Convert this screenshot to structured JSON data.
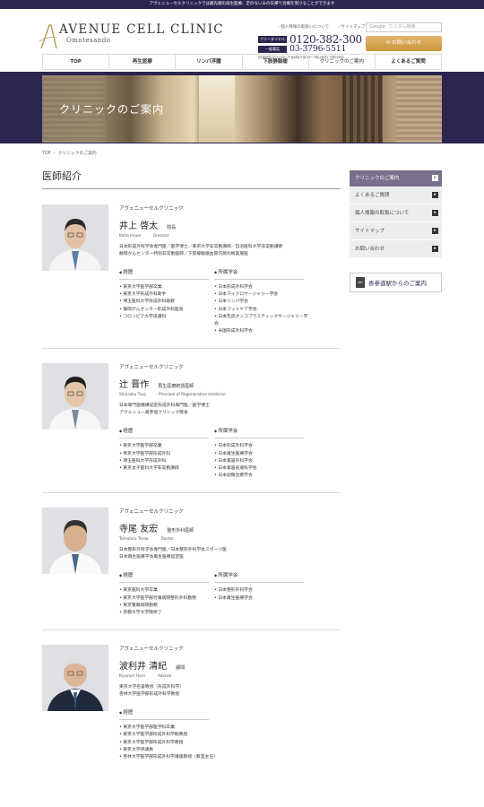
{
  "topbar": {
    "text": "アヴェニューセルクリニックでは最先端の再生医療、定のないみの日帰り治療を受けることができます"
  },
  "header": {
    "logo_main": "AVENUE CELL CLINIC",
    "logo_sub": "Omotesando",
    "links": [
      "個人情報の取扱いについて",
      "サイトマップ"
    ],
    "search_label": "Google",
    "search_placeholder": "カスタム検索",
    "phone1_label": "フリーダイヤル",
    "phone1": "0120-382-300",
    "phone2_label": "一般電話",
    "phone2": "03-3796-5511",
    "phone_note": "[診療時間]平日11時〜午後8時(午後2時〜3時は休診) 日曜日休診",
    "contact_button": "お問い合わせ"
  },
  "nav": [
    "TOP",
    "再生医療",
    "リンパ浮腫",
    "下肢静脈瘤",
    "クリニックのご案内",
    "よくあるご質問"
  ],
  "hero": {
    "title": "クリニックのご案内"
  },
  "breadcrumb": [
    "TOP",
    "クリニックのご案内"
  ],
  "page_title": "医師紹介",
  "doctors": [
    {
      "clinic": "アヴェニューセルクリニック",
      "name": "井上 啓太",
      "role": "院長",
      "name_en": "Keita Inoue",
      "role_en": "Director",
      "quals": [
        "日本形成外科学会専門医／医学博士／東京大学非常勤講師／自治医科大学非常勤講師",
        "静岡がんセンター特別非常勤医師／下肢静脈瘤血管内焼灼術実施医"
      ],
      "career_label": "経歴",
      "career": [
        "東京大学医学部卒業",
        "東京大学形成外科助手",
        "埼玉医科大学形成外科助教",
        "静岡がんセンター形成外科医長",
        "コロンビア大学皮膚科"
      ],
      "society_label": "所属学会",
      "society": [
        "日本形成外科学会",
        "日本マイクロサージャリー学会",
        "日本リンパ学会",
        "日本フットケア学会",
        "日本乳房オンコプラスティックサージャリー学会",
        "米国形成外科学会"
      ]
    },
    {
      "clinic": "アヴェニューセルクリニック",
      "name": "辻 晋作",
      "role": "再生医療統括医師",
      "name_en": "Shinsaku Tsuji",
      "role_en": "Principal of Regenerative medicine",
      "quals": [
        "日本専門医機構認定形成外科専門医／医学博士",
        "アヴェニュー表参道クリニック院長"
      ],
      "career_label": "経歴",
      "career": [
        "東京大学医学部卒業",
        "帝京大学医学部形成外科",
        "埼玉医科大学形成外科",
        "東京女子医科大学非常勤講師"
      ],
      "society_label": "所属学会",
      "society": [
        "日本形成外科学会",
        "日本再生医療学会",
        "日本美容外科学会",
        "日本美容皮膚科学会",
        "日本創傷治癒学会"
      ]
    },
    {
      "clinic": "アヴェニューセルクリニック",
      "name": "寺尾 友宏",
      "role": "整形外科医師",
      "name_en": "Tomohiro Terao",
      "role_en": "Doctor",
      "quals": [
        "日本整形外科学会専門医／日本整形外科学会スポーツ医",
        "日本再生医療学会再生医療認定医"
      ],
      "career_label": "経歴",
      "career": [
        "東京医科大学卒業",
        "東京大学医学部付属病院整形外科勤務",
        "東京警察病院勤務",
        "京都大学大学院修了"
      ],
      "society_label": "所属学会",
      "society": [
        "日本整形外科学会",
        "日本再生医療学会"
      ]
    },
    {
      "clinic": "アヴェニューセルクリニック",
      "name": "波利井 清紀",
      "role": "顧問",
      "name_en": "Kiyonori Harii",
      "role_en": "Adviser",
      "quals": [
        "東京大学名誉教授（形成外科学）",
        "杏林大学医学部形成外科学教授"
      ],
      "career_label": "経歴",
      "career": [
        "東京大学医学部医学科卒業",
        "東京大学医学部形成外科学助教授",
        "東京大学医学部形成外科学教授",
        "東京大学評議員",
        "杏林大学医学部形成外科学講座教授（教室主任）"
      ]
    }
  ],
  "sidebar": {
    "head": "クリニックのご案内",
    "items": [
      "よくあるご質問",
      "個人情報の取扱について",
      "サイトマップ",
      "お問い合わせ"
    ],
    "banner_icon": "PDF",
    "banner": "表参道駅からのご案内"
  }
}
